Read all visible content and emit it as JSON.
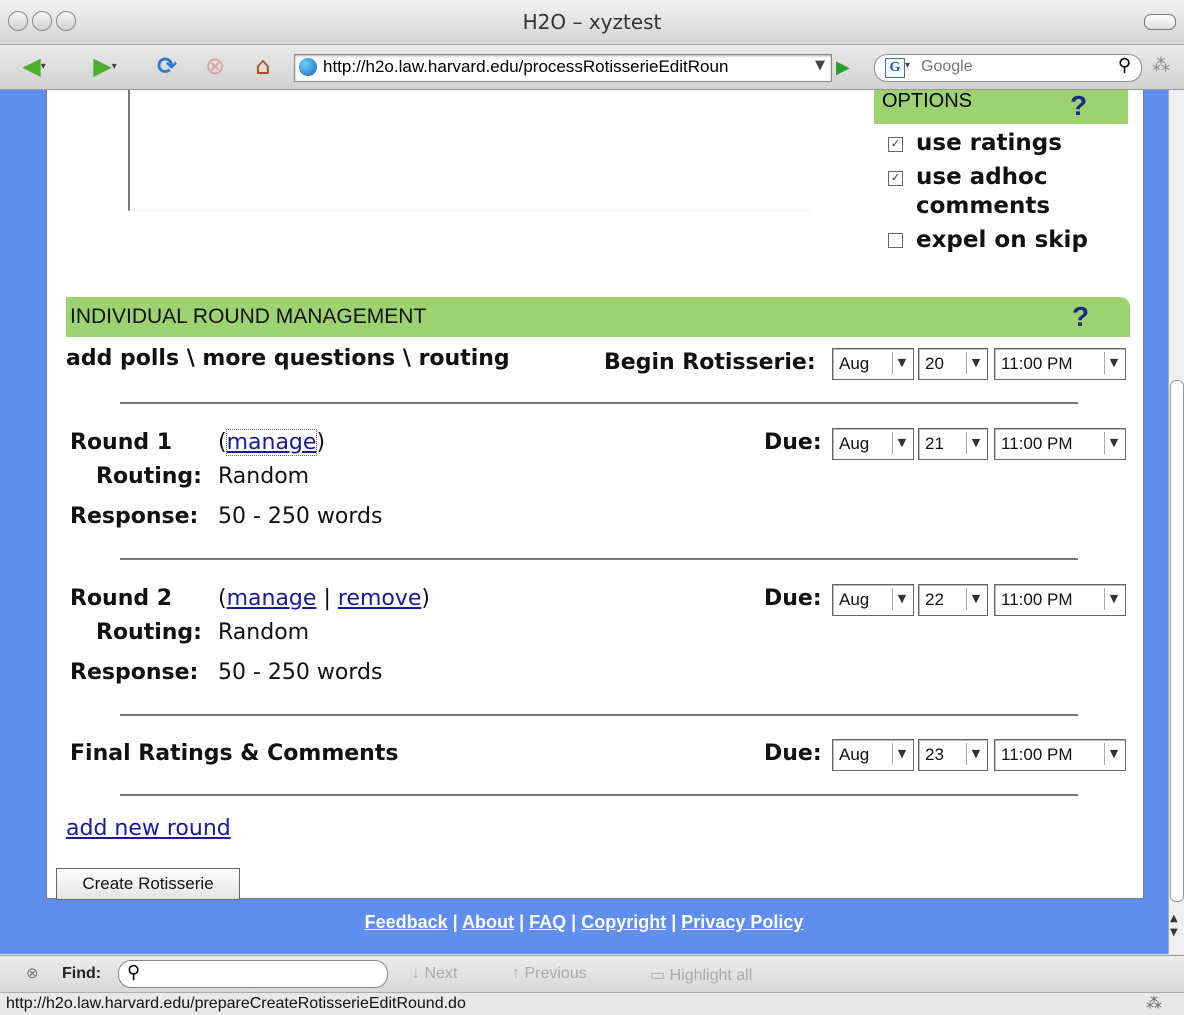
{
  "window": {
    "title": "H2O – xyztest"
  },
  "toolbar": {
    "url": "http://h2o.law.harvard.edu/processRotisserieEditRoun",
    "search_placeholder": "Google"
  },
  "options": {
    "label": "OPTIONS",
    "help": "?",
    "items": [
      {
        "label": "use ratings",
        "checked": true,
        "mark": "✓"
      },
      {
        "label": "use adhoc comments",
        "line1": "use adhoc",
        "line2": "comments",
        "checked": true,
        "mark": "✓"
      },
      {
        "label": "expel on skip",
        "checked": false,
        "mark": ""
      }
    ]
  },
  "irm": {
    "title": "INDIVIDUAL ROUND MANAGEMENT",
    "help": "?",
    "subtitle": "add polls \\ more questions \\ routing",
    "begin_label": "Begin Rotisserie:",
    "begin": {
      "month": "Aug",
      "day": "20",
      "time": "11:00 PM"
    }
  },
  "rounds": [
    {
      "name": "Round 1",
      "open_paren": "(",
      "manage": "manage",
      "close_paren": ")",
      "routing_label": "Routing:",
      "routing": "Random",
      "response_label": "Response:",
      "response": "50 - 250 words",
      "due_label": "Due:",
      "due": {
        "month": "Aug",
        "day": "21",
        "time": "11:00 PM"
      }
    },
    {
      "name": "Round 2",
      "open_paren": "(",
      "manage": "manage",
      "sep": "|",
      "remove": "remove",
      "close_paren": ")",
      "routing_label": "Routing:",
      "routing": "Random",
      "response_label": "Response:",
      "response": "50 - 250 words",
      "due_label": "Due:",
      "due": {
        "month": "Aug",
        "day": "22",
        "time": "11:00 PM"
      }
    }
  ],
  "final": {
    "name": "Final Ratings & Comments",
    "due_label": "Due:",
    "due": {
      "month": "Aug",
      "day": "23",
      "time": "11:00 PM"
    }
  },
  "add_round": "add new round",
  "create_button": "Create Rotisserie",
  "footer": {
    "links": [
      "Feedback",
      "About",
      "FAQ",
      "Copyright",
      "Privacy Policy"
    ],
    "sep": "|"
  },
  "findbar": {
    "label": "Find:",
    "next": "Next",
    "previous": "Previous",
    "highlight": "Highlight all"
  },
  "status": {
    "text": "http://h2o.law.harvard.edu/prepareCreateRotisserieEditRound.do"
  },
  "colors": {
    "green_header": "#9dd271",
    "blue_frame": "#5f8eef",
    "link": "#1a1a9c",
    "help": "#1a2a85"
  }
}
